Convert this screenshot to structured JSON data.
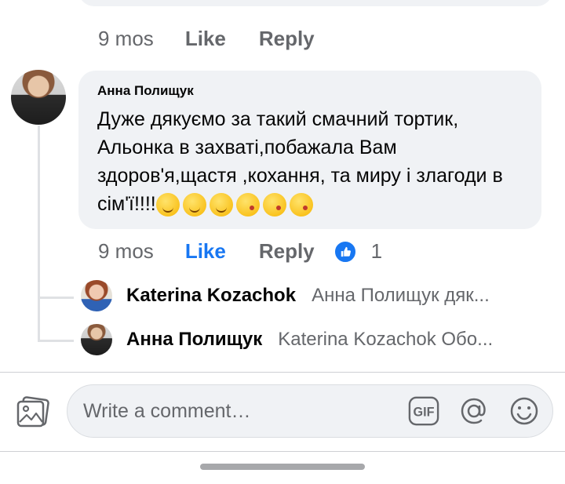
{
  "top_meta": {
    "time": "9 mos",
    "like": "Like",
    "reply": "Reply"
  },
  "comment": {
    "author": "Анна Полищук",
    "text": "Дуже дякуємо за такий смачний тортик, Альонка в захваті,побажала Вам здоров'я,щастя ,кохання, та миру і злагоди в сім'ї!!!!",
    "emojis": [
      "smiling-face-savoring-food-icon",
      "smiling-face-savoring-food-icon",
      "smiling-face-savoring-food-icon",
      "face-blowing-kiss-icon",
      "face-blowing-kiss-icon",
      "face-blowing-kiss-icon"
    ],
    "time": "9 mos",
    "like": "Like",
    "reply": "Reply",
    "reaction_count": "1"
  },
  "replies": [
    {
      "name": "Katerina Kozachok",
      "snippet": "Анна Полищук дяк..."
    },
    {
      "name": "Анна Полищук",
      "snippet": "Katerina Kozachok Обо..."
    }
  ],
  "composer": {
    "placeholder": "Write a comment…",
    "gif_label": "GIF"
  },
  "colors": {
    "accent": "#1877f2",
    "bubble": "#f0f2f5",
    "muted": "#65676b"
  }
}
